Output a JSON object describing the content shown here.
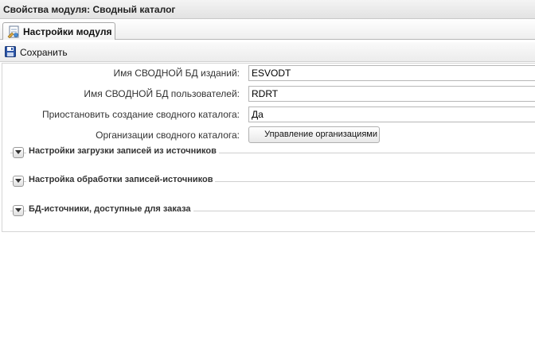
{
  "window": {
    "title": "Свойства модуля: Сводный каталог"
  },
  "tabs": [
    {
      "label": "Настройки модуля",
      "icon": "settings-page-icon"
    }
  ],
  "toolbar": {
    "save_label": "Сохранить",
    "save_icon": "floppy-disk-icon"
  },
  "form": {
    "fields": [
      {
        "label": "Имя СВОДНОЙ БД изданий:",
        "value": "ESVODT"
      },
      {
        "label": "Имя СВОДНОЙ БД пользователей:",
        "value": "RDRT"
      },
      {
        "label": "Приостановить создание сводного каталога:",
        "value": "Да"
      }
    ],
    "orgs": {
      "label": "Организации сводного каталога:",
      "button_label": "Управление организациями"
    }
  },
  "sections": [
    {
      "label": "Настройки загрузки записей из источников"
    },
    {
      "label": "Настройка обработки записей-источников"
    },
    {
      "label": "БД-источники, доступные для заказа"
    }
  ]
}
